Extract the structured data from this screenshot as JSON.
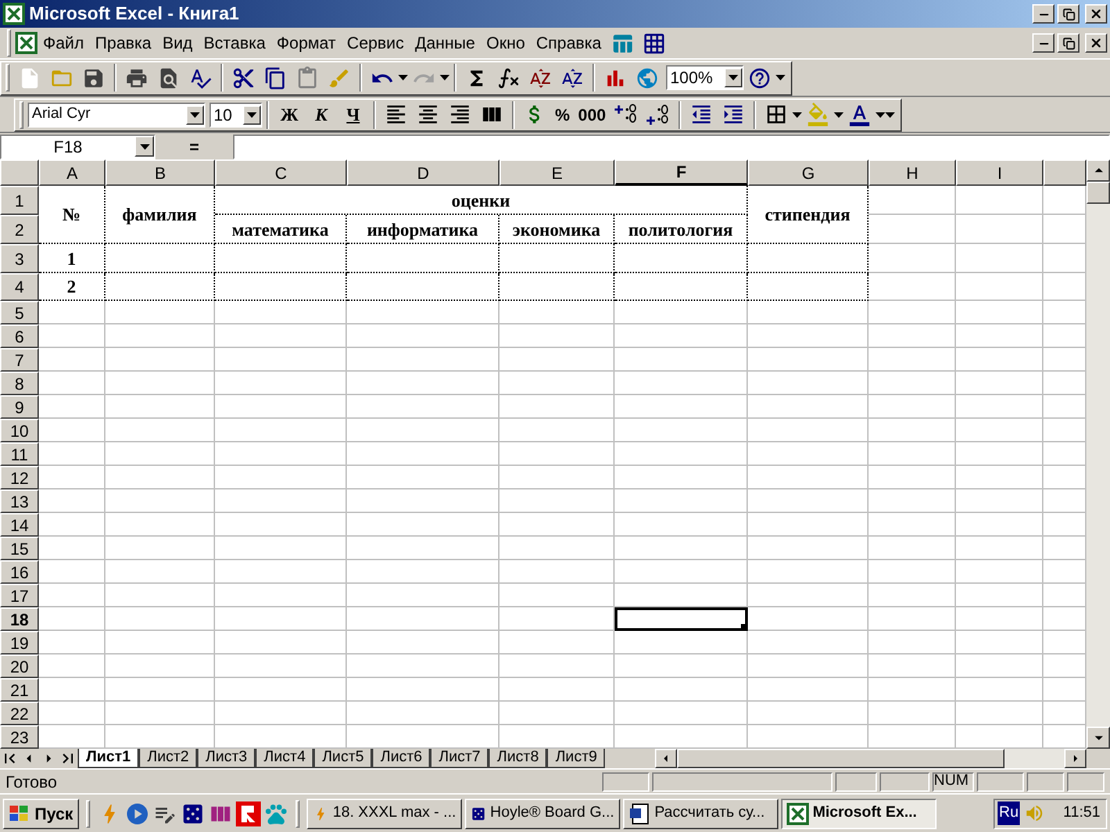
{
  "window": {
    "title": "Microsoft Excel - Книга1"
  },
  "menu": [
    "Файл",
    "Правка",
    "Вид",
    "Вставка",
    "Формат",
    "Сервис",
    "Данные",
    "Окно",
    "Справка"
  ],
  "standard_toolbar": {
    "paste_disabled": true,
    "redo_disabled": true,
    "zoom": "100%"
  },
  "formatting_toolbar": {
    "font": "Arial Cyr",
    "size": "10",
    "styles": [
      {
        "label": "Ж",
        "kind": "bold"
      },
      {
        "label": "К",
        "kind": "italic"
      },
      {
        "label": "Ч",
        "kind": "underline"
      }
    ],
    "number_formats": [
      "%",
      "000"
    ]
  },
  "formula_bar": {
    "name_box": "F18",
    "equals": "="
  },
  "sheet": {
    "columns": [
      {
        "label": "A",
        "selected": false
      },
      {
        "label": "B",
        "selected": false
      },
      {
        "label": "C",
        "selected": false
      },
      {
        "label": "D",
        "selected": false
      },
      {
        "label": "E",
        "selected": false
      },
      {
        "label": "F",
        "selected": true
      },
      {
        "label": "G",
        "selected": false
      },
      {
        "label": "H",
        "selected": false
      },
      {
        "label": "I",
        "selected": false
      }
    ],
    "rows": [
      {
        "label": "1",
        "selected": false
      },
      {
        "label": "2",
        "selected": false
      },
      {
        "label": "3",
        "selected": false
      },
      {
        "label": "4",
        "selected": false
      },
      {
        "label": "5",
        "selected": false
      },
      {
        "label": "6",
        "selected": false
      },
      {
        "label": "7",
        "selected": false
      },
      {
        "label": "8",
        "selected": false
      },
      {
        "label": "9",
        "selected": false
      },
      {
        "label": "10",
        "selected": false
      },
      {
        "label": "11",
        "selected": false
      },
      {
        "label": "12",
        "selected": false
      },
      {
        "label": "13",
        "selected": false
      },
      {
        "label": "14",
        "selected": false
      },
      {
        "label": "15",
        "selected": false
      },
      {
        "label": "16",
        "selected": false
      },
      {
        "label": "17",
        "selected": false
      },
      {
        "label": "18",
        "selected": true
      },
      {
        "label": "19",
        "selected": false
      },
      {
        "label": "20",
        "selected": false
      },
      {
        "label": "21",
        "selected": false
      },
      {
        "label": "22",
        "selected": false
      },
      {
        "label": "23",
        "selected": false
      }
    ],
    "table": {
      "number_header": "№",
      "surname_header": "фамилия",
      "grades_header": "оценки",
      "subjects": [
        "математика",
        "информатика",
        "экономика",
        "политология"
      ],
      "scholarship_header": "стипендия",
      "rows": [
        {
          "number": "1"
        },
        {
          "number": "2"
        }
      ]
    }
  },
  "sheet_tabs": [
    {
      "label": "Лист1",
      "selected": true
    },
    {
      "label": "Лист2",
      "selected": false
    },
    {
      "label": "Лист3",
      "selected": false
    },
    {
      "label": "Лист4",
      "selected": false
    },
    {
      "label": "Лист5",
      "selected": false
    },
    {
      "label": "Лист6",
      "selected": false
    },
    {
      "label": "Лист7",
      "selected": false
    },
    {
      "label": "Лист8",
      "selected": false
    },
    {
      "label": "Лист9",
      "selected": false
    }
  ],
  "status_bar": {
    "text": "Готово",
    "indicator": "NUM"
  },
  "taskbar": {
    "start": "Пуск",
    "tasks": [
      {
        "label": "18. XXXL max - ...",
        "kind": "player",
        "selected": false
      },
      {
        "label": "Hoyle® Board G...",
        "kind": "game",
        "selected": false
      },
      {
        "label": "Рассчитать су...",
        "kind": "word",
        "selected": false
      },
      {
        "label": "Microsoft Ex...",
        "kind": "excel",
        "selected": true
      }
    ],
    "language": "Ru",
    "time": "11:51"
  }
}
